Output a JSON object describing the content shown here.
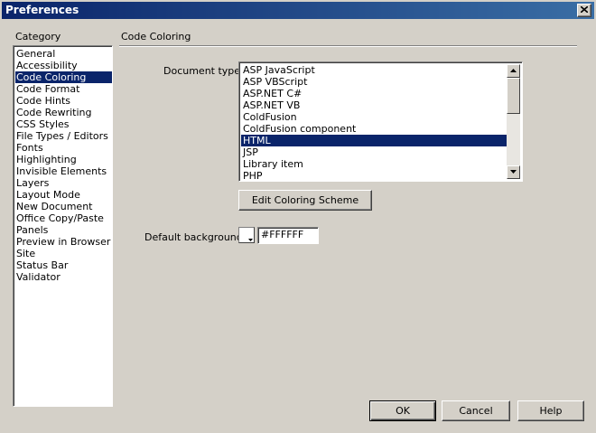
{
  "window": {
    "title": "Preferences"
  },
  "category": {
    "label": "Category",
    "items": [
      {
        "label": "General"
      },
      {
        "label": "Accessibility"
      },
      {
        "label": "Code Coloring",
        "selected": true
      },
      {
        "label": "Code Format"
      },
      {
        "label": "Code Hints"
      },
      {
        "label": "Code Rewriting"
      },
      {
        "label": "CSS Styles"
      },
      {
        "label": "File Types / Editors"
      },
      {
        "label": "Fonts"
      },
      {
        "label": "Highlighting"
      },
      {
        "label": "Invisible Elements"
      },
      {
        "label": "Layers"
      },
      {
        "label": "Layout Mode"
      },
      {
        "label": "New Document"
      },
      {
        "label": "Office Copy/Paste"
      },
      {
        "label": "Panels"
      },
      {
        "label": "Preview in Browser"
      },
      {
        "label": "Site"
      },
      {
        "label": "Status Bar"
      },
      {
        "label": "Validator"
      }
    ]
  },
  "panel": {
    "title": "Code Coloring",
    "document_type_label": "Document type:",
    "document_types": [
      {
        "label": "ASP JavaScript"
      },
      {
        "label": "ASP VBScript"
      },
      {
        "label": "ASP.NET C#"
      },
      {
        "label": "ASP.NET VB"
      },
      {
        "label": "ColdFusion"
      },
      {
        "label": "ColdFusion component"
      },
      {
        "label": "HTML",
        "selected": true
      },
      {
        "label": "JSP"
      },
      {
        "label": "Library item"
      },
      {
        "label": "PHP"
      }
    ],
    "edit_scheme_label": "Edit Coloring Scheme",
    "default_background_label": "Default background:",
    "default_background_value": "#FFFFFF"
  },
  "buttons": {
    "ok": "OK",
    "cancel": "Cancel",
    "help": "Help"
  },
  "colors": {
    "selection": "#0a246a",
    "face": "#d4d0c8",
    "swatch": "#FFFFFF"
  },
  "icons": {
    "close": "close-icon",
    "scroll_up": "scroll-up-arrow-icon",
    "scroll_down": "scroll-down-arrow-icon",
    "swatch_dropdown": "dropdown-arrow-icon"
  }
}
